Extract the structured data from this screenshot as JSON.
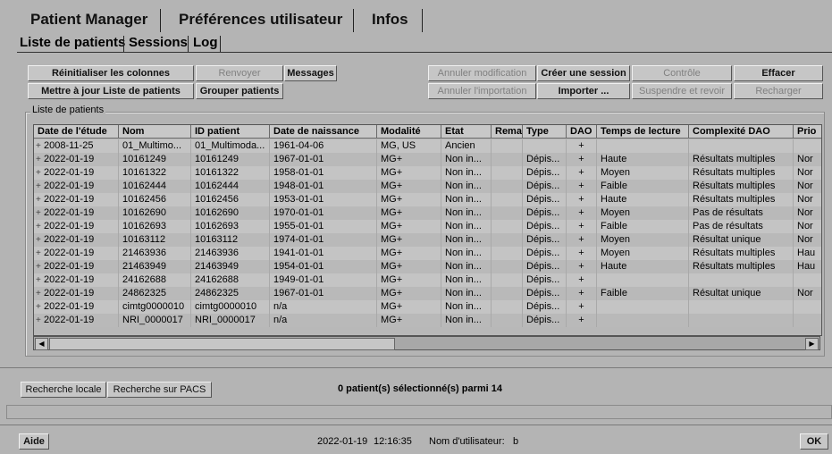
{
  "top_tabs": [
    "Patient Manager",
    "Préférences utilisateur",
    "Infos"
  ],
  "sub_tabs": [
    "Liste de patients",
    "Sessions",
    "Log"
  ],
  "buttons": {
    "reset_columns": "Réinitialiser les colonnes",
    "resend": "Renvoyer",
    "messages": "Messages",
    "cancel_modification": "Annuler modification",
    "create_session": "Créer une session",
    "control": "Contrôle",
    "delete": "Effacer",
    "update_list": "Mettre à jour Liste de patients",
    "group_patients": "Grouper patients",
    "cancel_import": "Annuler l'importation",
    "import": "Importer ...",
    "suspend": "Suspendre et revoir",
    "reload": "Recharger",
    "local_search": "Recherche locale",
    "pacs_search": "Recherche sur PACS",
    "help": "Aide",
    "ok": "OK"
  },
  "group_title": "Liste de patients",
  "table": {
    "columns": [
      "Date de l'étude",
      "Nom",
      "ID patient",
      "Date de naissance",
      "Modalité",
      "Etat",
      "Rema",
      "Type",
      "DAO",
      "Temps de lecture",
      "Complexité DAO",
      "Prio"
    ],
    "rows": [
      [
        "2008-11-25",
        "01_Multimo...",
        "01_Multimoda...",
        "1961-04-06",
        "MG, US",
        "Ancien",
        "",
        "",
        "+",
        "",
        "",
        ""
      ],
      [
        "2022-01-19",
        "10161249",
        "10161249",
        "1967-01-01",
        "MG+",
        "Non in...",
        "",
        "Dépis...",
        "+",
        "Haute",
        "Résultats multiples",
        "Nor"
      ],
      [
        "2022-01-19",
        "10161322",
        "10161322",
        "1958-01-01",
        "MG+",
        "Non in...",
        "",
        "Dépis...",
        "+",
        "Moyen",
        "Résultats multiples",
        "Nor"
      ],
      [
        "2022-01-19",
        "10162444",
        "10162444",
        "1948-01-01",
        "MG+",
        "Non in...",
        "",
        "Dépis...",
        "+",
        "Faible",
        "Résultats multiples",
        "Nor"
      ],
      [
        "2022-01-19",
        "10162456",
        "10162456",
        "1953-01-01",
        "MG+",
        "Non in...",
        "",
        "Dépis...",
        "+",
        "Haute",
        "Résultats multiples",
        "Nor"
      ],
      [
        "2022-01-19",
        "10162690",
        "10162690",
        "1970-01-01",
        "MG+",
        "Non in...",
        "",
        "Dépis...",
        "+",
        "Moyen",
        "Pas de résultats",
        "Nor"
      ],
      [
        "2022-01-19",
        "10162693",
        "10162693",
        "1955-01-01",
        "MG+",
        "Non in...",
        "",
        "Dépis...",
        "+",
        "Faible",
        "Pas de résultats",
        "Nor"
      ],
      [
        "2022-01-19",
        "10163112",
        "10163112",
        "1974-01-01",
        "MG+",
        "Non in...",
        "",
        "Dépis...",
        "+",
        "Moyen",
        "Résultat unique",
        "Nor"
      ],
      [
        "2022-01-19",
        "21463936",
        "21463936",
        "1941-01-01",
        "MG+",
        "Non in...",
        "",
        "Dépis...",
        "+",
        "Moyen",
        "Résultats multiples",
        "Hau"
      ],
      [
        "2022-01-19",
        "21463949",
        "21463949",
        "1954-01-01",
        "MG+",
        "Non in...",
        "",
        "Dépis...",
        "+",
        "Haute",
        "Résultats multiples",
        "Hau"
      ],
      [
        "2022-01-19",
        "24162688",
        "24162688",
        "1949-01-01",
        "MG+",
        "Non in...",
        "",
        "Dépis...",
        "+",
        "",
        "",
        ""
      ],
      [
        "2022-01-19",
        "24862325",
        "24862325",
        "1967-01-01",
        "MG+",
        "Non in...",
        "",
        "Dépis...",
        "+",
        "Faible",
        "Résultat unique",
        "Nor"
      ],
      [
        "2022-01-19",
        "cimtg0000010",
        "cimtg0000010",
        "n/a",
        "MG+",
        "Non in...",
        "",
        "Dépis...",
        "+",
        "",
        "",
        ""
      ],
      [
        "2022-01-19",
        "NRI_0000017",
        "NRI_0000017",
        "n/a",
        "MG+",
        "Non in...",
        "",
        "Dépis...",
        "+",
        "",
        "",
        ""
      ]
    ]
  },
  "selection_status": "0 patient(s) sélectionné(s) parmi 14",
  "footer": {
    "date": "2022-01-19",
    "time": "12:16:35",
    "user_label": "Nom d'utilisateur:",
    "user": "b"
  }
}
